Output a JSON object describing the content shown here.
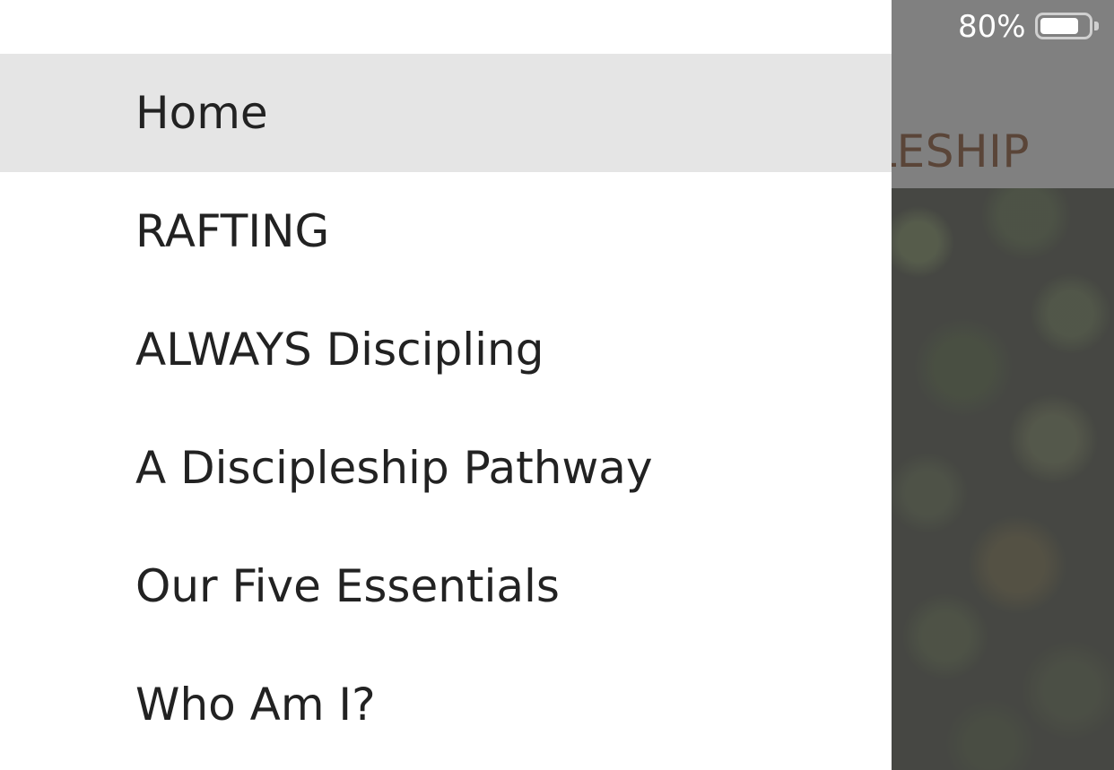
{
  "status_bar": {
    "battery_percent_text": "80%",
    "battery_level": 0.8,
    "battery_icon": "battery-icon"
  },
  "background_page": {
    "header_title_visible": "LESHIP"
  },
  "menu": {
    "active_index": 0,
    "items": [
      {
        "label": "Home"
      },
      {
        "label": "RAFTING"
      },
      {
        "label": "ALWAYS Discipling"
      },
      {
        "label": "A Discipleship Pathway"
      },
      {
        "label": "Our Five Essentials"
      },
      {
        "label": "Who Am I?"
      }
    ]
  },
  "colors": {
    "menu_active_bg": "#e5e5e5",
    "menu_text": "#222222",
    "overlay_header": "#808080",
    "header_title": "#5a4538"
  }
}
